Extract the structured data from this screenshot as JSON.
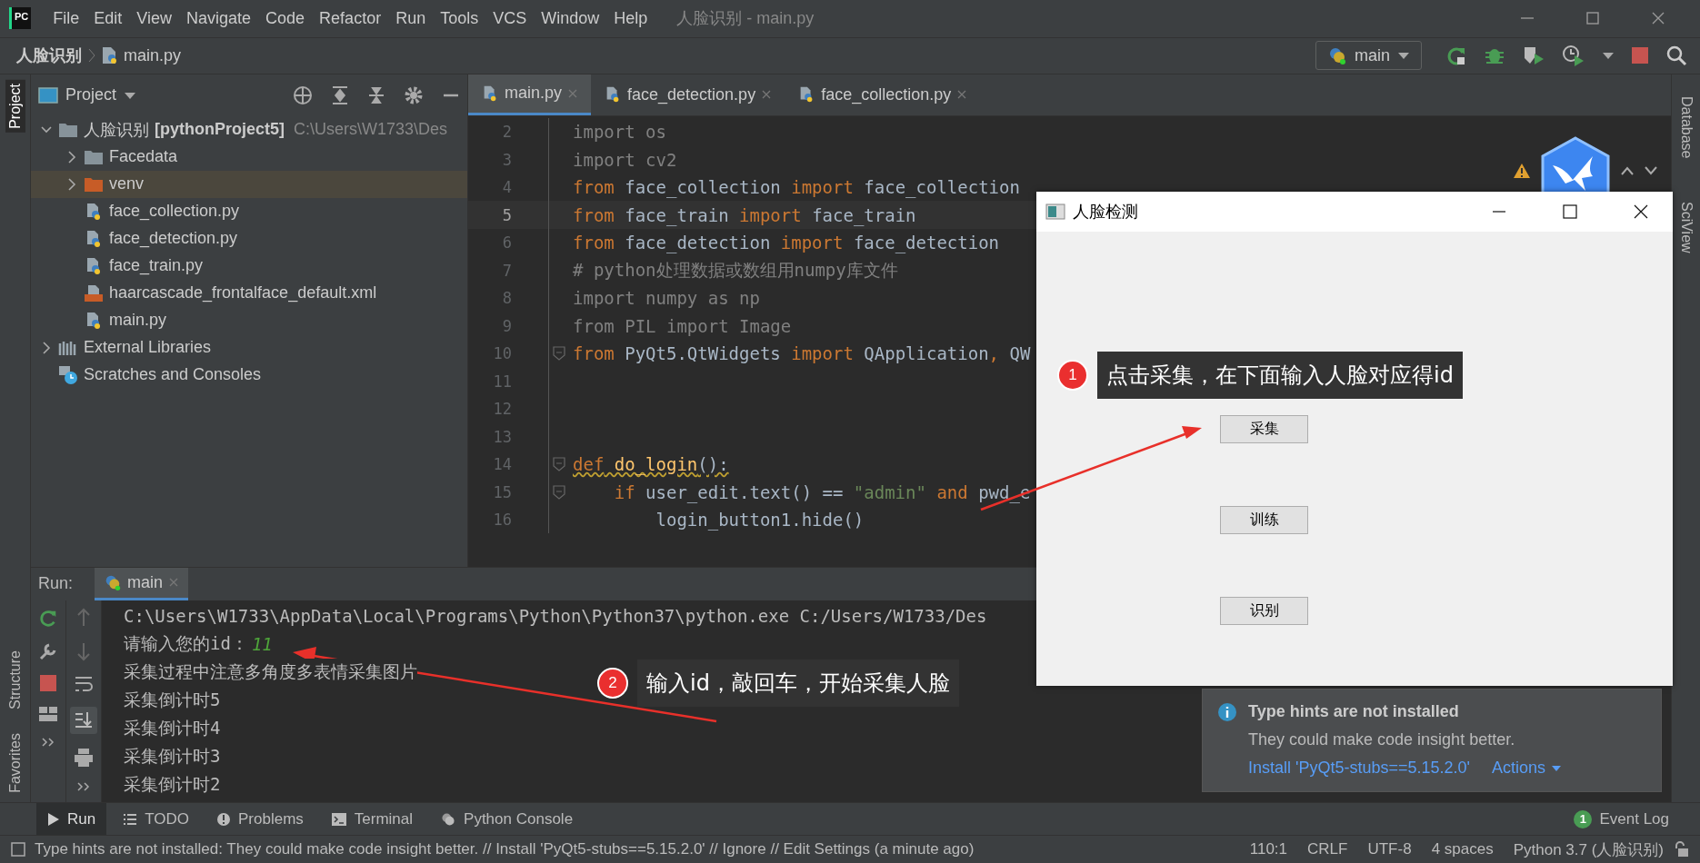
{
  "window": {
    "app_icon": "PC",
    "menu": [
      "File",
      "Edit",
      "View",
      "Navigate",
      "Code",
      "Refactor",
      "Run",
      "Tools",
      "VCS",
      "Window",
      "Help"
    ],
    "title": "人脸识别 - main.py"
  },
  "navbar": {
    "project": "人脸识别",
    "file": "main.py",
    "run_config": "main"
  },
  "side_stripes": {
    "left_top": [
      {
        "label": "Project",
        "selected": true
      }
    ],
    "left_bottom": [
      {
        "label": "Structure",
        "selected": false
      },
      {
        "label": "Favorites",
        "selected": false
      }
    ],
    "right": [
      {
        "label": "Database",
        "selected": false
      },
      {
        "label": "SciView",
        "selected": false
      }
    ]
  },
  "project": {
    "title": "Project",
    "tree": [
      {
        "name": "人脸识别",
        "module": "[pythonProject5]",
        "path": "C:\\Users\\W1733\\Des",
        "kind": "folder",
        "expanded": true,
        "selected": false,
        "children": [
          {
            "name": "Facedata",
            "kind": "folder",
            "expanded": false,
            "selected": false
          },
          {
            "name": "venv",
            "kind": "excluded",
            "expanded": false,
            "selected": true
          },
          {
            "name": "face_collection.py",
            "kind": "python",
            "selected": false
          },
          {
            "name": "face_detection.py",
            "kind": "python",
            "selected": false
          },
          {
            "name": "face_train.py",
            "kind": "python",
            "selected": false
          },
          {
            "name": "haarcascade_frontalface_default.xml",
            "kind": "xml",
            "selected": false
          },
          {
            "name": "main.py",
            "kind": "python",
            "selected": false
          }
        ]
      },
      {
        "name": "External Libraries",
        "kind": "libraries",
        "expanded": false,
        "selected": false
      },
      {
        "name": "Scratches and Consoles",
        "kind": "scratches",
        "selected": false
      }
    ]
  },
  "editor": {
    "tabs": [
      {
        "label": "main.py",
        "selected": true
      },
      {
        "label": "face_detection.py",
        "selected": false
      },
      {
        "label": "face_collection.py",
        "selected": false
      }
    ],
    "lines": [
      {
        "number": "2",
        "current": false,
        "fold": false,
        "tokens": [
          {
            "text": "import os",
            "kind": "unused"
          }
        ]
      },
      {
        "number": "3",
        "current": false,
        "fold": false,
        "tokens": [
          {
            "text": "import cv2",
            "kind": "unused"
          }
        ]
      },
      {
        "number": "4",
        "current": false,
        "fold": false,
        "tokens": [
          {
            "text": "from",
            "kind": "keyword"
          },
          {
            "text": " face_collection ",
            "kind": "name"
          },
          {
            "text": "import",
            "kind": "keyword"
          },
          {
            "text": " face_collection",
            "kind": "name"
          }
        ]
      },
      {
        "number": "5",
        "current": true,
        "fold": false,
        "tokens": [
          {
            "text": "from",
            "kind": "keyword"
          },
          {
            "text": " face_train ",
            "kind": "name"
          },
          {
            "text": "import",
            "kind": "keyword"
          },
          {
            "text": " face_train",
            "kind": "name"
          }
        ]
      },
      {
        "number": "6",
        "current": false,
        "fold": false,
        "tokens": [
          {
            "text": "from",
            "kind": "keyword"
          },
          {
            "text": " face_detection ",
            "kind": "name"
          },
          {
            "text": "import",
            "kind": "keyword"
          },
          {
            "text": " face_detection",
            "kind": "name"
          }
        ]
      },
      {
        "number": "7",
        "current": false,
        "fold": false,
        "tokens": [
          {
            "text": "# python处理数据或数组用numpy库文件",
            "kind": "comment"
          }
        ]
      },
      {
        "number": "8",
        "current": false,
        "fold": false,
        "tokens": [
          {
            "text": "import numpy as np",
            "kind": "unused"
          }
        ]
      },
      {
        "number": "9",
        "current": false,
        "fold": false,
        "tokens": [
          {
            "text": "from PIL import Image",
            "kind": "unused"
          }
        ]
      },
      {
        "number": "10",
        "current": false,
        "fold": true,
        "tokens": [
          {
            "text": "from",
            "kind": "keyword"
          },
          {
            "text": " PyQt5.QtWidgets ",
            "kind": "name"
          },
          {
            "text": "import",
            "kind": "keyword"
          },
          {
            "text": " QApplication",
            "kind": "name"
          },
          {
            "text": ",",
            "kind": "keyword"
          },
          {
            "text": " QW",
            "kind": "name"
          }
        ]
      },
      {
        "number": "11",
        "current": false,
        "fold": false
      },
      {
        "number": "12",
        "current": false,
        "fold": false
      },
      {
        "number": "13",
        "current": false,
        "fold": false
      },
      {
        "number": "14",
        "current": false,
        "fold": true,
        "warning": true,
        "tokens": [
          {
            "text": "def",
            "kind": "keyword"
          },
          {
            "text": " do_login",
            "kind": "function"
          },
          {
            "text": "():",
            "kind": "name"
          }
        ]
      },
      {
        "number": "15",
        "current": false,
        "fold": true,
        "tokens": [
          {
            "text": "    if",
            "kind": "keyword"
          },
          {
            "text": " user_edit.text() == ",
            "kind": "name"
          },
          {
            "text": "\"admin\"",
            "kind": "string"
          },
          {
            "text": " and",
            "kind": "keyword"
          },
          {
            "text": " pwd_e",
            "kind": "name"
          }
        ]
      },
      {
        "number": "16",
        "current": false,
        "fold": false,
        "tokens": [
          {
            "text": "        login_button1.hide()",
            "kind": "name"
          }
        ]
      }
    ]
  },
  "run": {
    "label": "Run:",
    "tab": "main",
    "console": [
      [
        {
          "text": "C:\\Users\\W1733\\AppData\\Local\\Programs\\Python\\Python37\\python.exe C:/Users/W1733/Des",
          "kind": "output"
        }
      ],
      [
        {
          "text": "请输入您的id：",
          "kind": "output"
        },
        {
          "text": "11",
          "kind": "input"
        }
      ],
      [
        {
          "text": "采集过程中注意多角度多表情采集图片",
          "kind": "output"
        }
      ],
      [
        {
          "text": "采集倒计时5",
          "kind": "output"
        }
      ],
      [
        {
          "text": "采集倒计时4",
          "kind": "output"
        }
      ],
      [
        {
          "text": "采集倒计时3",
          "kind": "output"
        }
      ],
      [
        {
          "text": "采集倒计时2",
          "kind": "output"
        }
      ]
    ]
  },
  "dialog": {
    "title": "人脸检测",
    "buttons": [
      "采集",
      "训练",
      "识别"
    ]
  },
  "annotations": [
    {
      "number": "1",
      "text": "点击采集，在下面输入人脸对应得id"
    },
    {
      "number": "2",
      "text": "输入id，敲回车，开始采集人脸"
    }
  ],
  "notification": {
    "title": "Type hints are not installed",
    "body": "They could make code insight better.",
    "link": "Install 'PyQt5-stubs==5.15.2.0'",
    "actions": "Actions"
  },
  "tool_tabs": [
    {
      "label": "Run",
      "kind": "run",
      "selected": true
    },
    {
      "label": "TODO",
      "kind": "todo",
      "selected": false
    },
    {
      "label": "Problems",
      "kind": "problems",
      "selected": false
    },
    {
      "label": "Terminal",
      "kind": "terminal",
      "selected": false
    },
    {
      "label": "Python Console",
      "kind": "python",
      "selected": false
    }
  ],
  "event_log": {
    "label": "Event Log",
    "count": "1"
  },
  "status_bar": {
    "message": "Type hints are not installed: They could make code insight better. // Install 'PyQt5-stubs==5.15.2.0' // Ignore // Edit Settings (a minute ago)",
    "items": [
      "110:1",
      "CRLF",
      "UTF-8",
      "4 spaces",
      "Python 3.7 (人脸识别)"
    ]
  }
}
